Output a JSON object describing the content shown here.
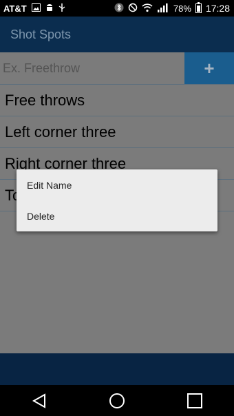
{
  "status_bar": {
    "carrier": "AT&T",
    "battery": "78%",
    "time": "17:28",
    "left_icons": [
      "image-icon",
      "android-icon",
      "usb-icon"
    ],
    "right_icons": [
      "bluetooth-icon",
      "do-not-disturb-icon",
      "wifi-icon",
      "signal-icon",
      "battery-icon"
    ]
  },
  "app_bar": {
    "title": "Shot Spots"
  },
  "add_row": {
    "placeholder": "Ex. Freethrow",
    "add_label": "+"
  },
  "list": {
    "items": [
      {
        "label": "Free throws"
      },
      {
        "label": "Left corner three"
      },
      {
        "label": "Right corner three"
      },
      {
        "label": "To"
      }
    ]
  },
  "context_menu": {
    "items": [
      {
        "label": "Edit Name"
      },
      {
        "label": "Delete"
      }
    ]
  },
  "nav_bar": {
    "buttons": [
      "back-icon",
      "home-icon",
      "recents-icon"
    ]
  },
  "colors": {
    "app_bar": "#0b2d4f",
    "add_button": "#1a5d8e",
    "dim_overlay": "#7b7b7b",
    "menu_bg": "#ececec"
  }
}
